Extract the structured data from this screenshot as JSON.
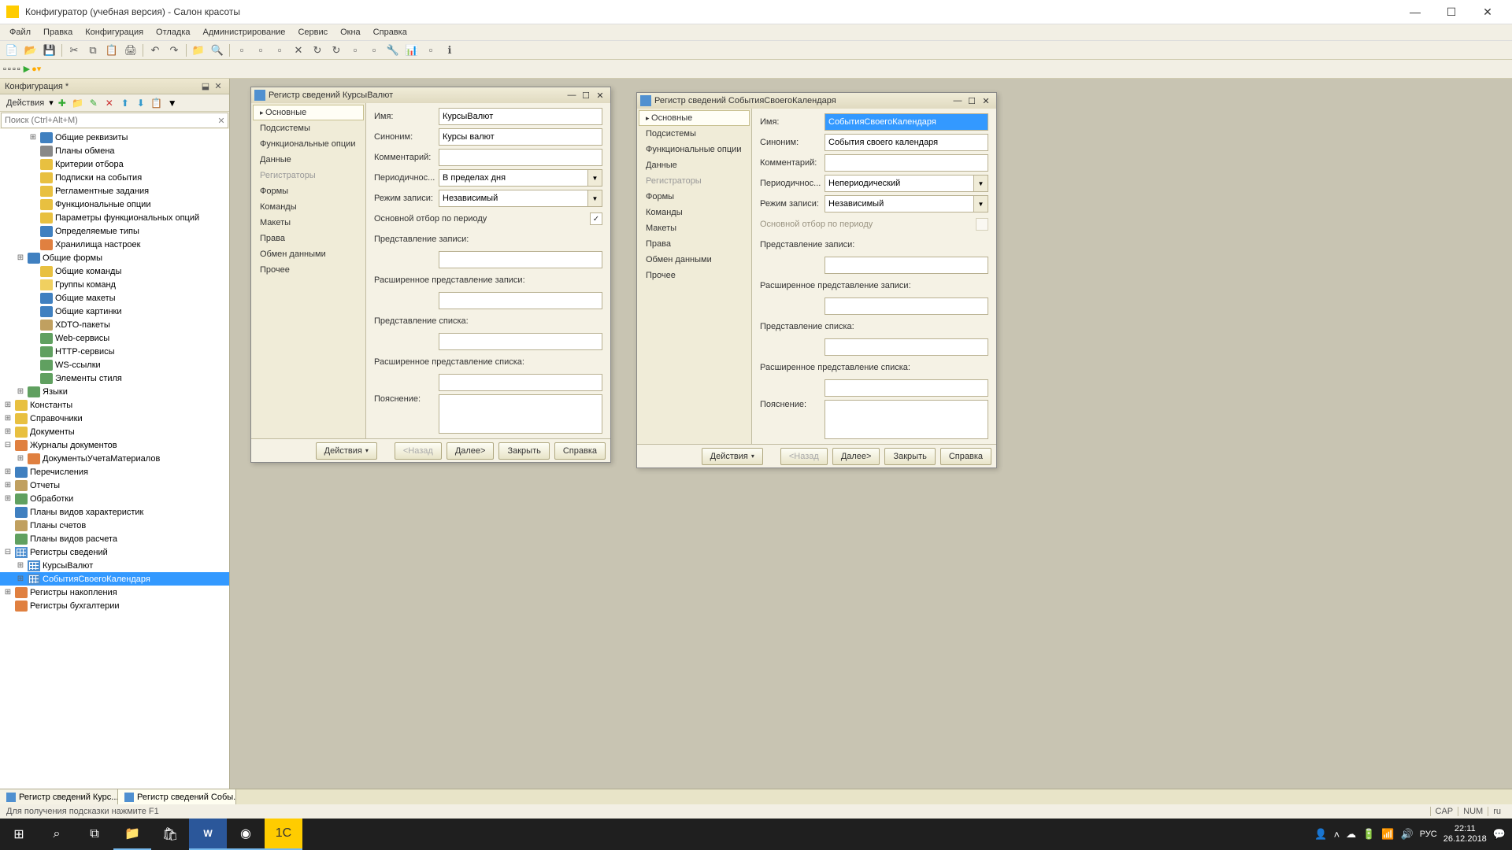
{
  "titlebar": {
    "title": "Конфигуратор (учебная версия) - Салон красоты"
  },
  "menubar": [
    "Файл",
    "Правка",
    "Конфигурация",
    "Отладка",
    "Администрирование",
    "Сервис",
    "Окна",
    "Справка"
  ],
  "config_panel": {
    "header": "Конфигурация *",
    "actions_label": "Действия",
    "search_placeholder": "Поиск (Ctrl+Alt+M)"
  },
  "tree": [
    {
      "d": 2,
      "t": "+",
      "ic": "blue",
      "label": "Общие реквизиты"
    },
    {
      "d": 2,
      "t": "",
      "ic": "grey",
      "label": "Планы обмена"
    },
    {
      "d": 2,
      "t": "",
      "ic": "yellow",
      "label": "Критерии отбора"
    },
    {
      "d": 2,
      "t": "",
      "ic": "yellow",
      "label": "Подписки на события"
    },
    {
      "d": 2,
      "t": "",
      "ic": "yellow",
      "label": "Регламентные задания"
    },
    {
      "d": 2,
      "t": "",
      "ic": "yellow",
      "label": "Функциональные опции"
    },
    {
      "d": 2,
      "t": "",
      "ic": "yellow",
      "label": "Параметры функциональных опций"
    },
    {
      "d": 2,
      "t": "",
      "ic": "blue",
      "label": "Определяемые типы"
    },
    {
      "d": 2,
      "t": "",
      "ic": "orange",
      "label": "Хранилища настроек"
    },
    {
      "d": 1,
      "t": "+",
      "ic": "blue",
      "label": "Общие формы"
    },
    {
      "d": 2,
      "t": "",
      "ic": "yellow",
      "label": "Общие команды"
    },
    {
      "d": 2,
      "t": "",
      "ic": "folder",
      "label": "Группы команд"
    },
    {
      "d": 2,
      "t": "",
      "ic": "blue",
      "label": "Общие макеты"
    },
    {
      "d": 2,
      "t": "",
      "ic": "blue",
      "label": "Общие картинки"
    },
    {
      "d": 2,
      "t": "",
      "ic": "tan",
      "label": "XDTO-пакеты"
    },
    {
      "d": 2,
      "t": "",
      "ic": "green",
      "label": "Web-сервисы"
    },
    {
      "d": 2,
      "t": "",
      "ic": "green",
      "label": "HTTP-сервисы"
    },
    {
      "d": 2,
      "t": "",
      "ic": "green",
      "label": "WS-ссылки"
    },
    {
      "d": 2,
      "t": "",
      "ic": "green",
      "label": "Элементы стиля"
    },
    {
      "d": 1,
      "t": "+",
      "ic": "green",
      "label": "Языки"
    },
    {
      "d": 0,
      "t": "+",
      "ic": "yellow",
      "label": "Константы"
    },
    {
      "d": 0,
      "t": "+",
      "ic": "yellow",
      "label": "Справочники"
    },
    {
      "d": 0,
      "t": "+",
      "ic": "yellow",
      "label": "Документы"
    },
    {
      "d": 0,
      "t": "-",
      "ic": "orange",
      "label": "Журналы документов"
    },
    {
      "d": 1,
      "t": "+",
      "ic": "orange",
      "label": "ДокументыУчетаМатериалов"
    },
    {
      "d": 0,
      "t": "+",
      "ic": "blue",
      "label": "Перечисления"
    },
    {
      "d": 0,
      "t": "+",
      "ic": "tan",
      "label": "Отчеты"
    },
    {
      "d": 0,
      "t": "+",
      "ic": "green",
      "label": "Обработки"
    },
    {
      "d": 0,
      "t": "",
      "ic": "blue",
      "label": "Планы видов характеристик"
    },
    {
      "d": 0,
      "t": "",
      "ic": "tan",
      "label": "Планы счетов"
    },
    {
      "d": 0,
      "t": "",
      "ic": "green",
      "label": "Планы видов расчета"
    },
    {
      "d": 0,
      "t": "-",
      "ic": "grid",
      "label": "Регистры сведений"
    },
    {
      "d": 1,
      "t": "+",
      "ic": "grid",
      "label": "КурсыВалют"
    },
    {
      "d": 1,
      "t": "+",
      "ic": "grid",
      "label": "СобытияСвоегоКалендаря",
      "sel": true
    },
    {
      "d": 0,
      "t": "+",
      "ic": "orange",
      "label": "Регистры накопления"
    },
    {
      "d": 0,
      "t": "",
      "ic": "orange",
      "label": "Регистры бухгалтерии"
    }
  ],
  "reg_nav": [
    {
      "label": "Основные",
      "active": true
    },
    {
      "label": "Подсистемы"
    },
    {
      "label": "Функциональные опции"
    },
    {
      "label": "Данные"
    },
    {
      "label": "Регистраторы",
      "muted": true
    },
    {
      "label": "Формы"
    },
    {
      "label": "Команды"
    },
    {
      "label": "Макеты"
    },
    {
      "label": "Права"
    },
    {
      "label": "Обмен данными"
    },
    {
      "label": "Прочее"
    }
  ],
  "form_labels": {
    "name": "Имя:",
    "synonym": "Синоним:",
    "comment": "Комментарий:",
    "periodicity": "Периодичнос...",
    "recmode": "Режим записи:",
    "mainfilter": "Основной отбор по периоду",
    "recview": "Представление записи:",
    "recview_ext": "Расширенное представление записи:",
    "listview": "Представление списка:",
    "listview_ext": "Расширенное представление списка:",
    "explain": "Пояснение:"
  },
  "window1": {
    "title": "Регистр сведений КурсыВалют",
    "name": "КурсыВалют",
    "synonym": "Курсы валют",
    "comment": "",
    "periodicity": "В пределах дня",
    "recmode": "Независимый",
    "mainfilter_checked": true
  },
  "window2": {
    "title": "Регистр сведений СобытияСвоегоКалендаря",
    "name": "СобытияСвоегоКалендаря",
    "synonym": "События своего календаря",
    "comment": "",
    "periodicity": "Непериодический",
    "recmode": "Независимый",
    "mainfilter_checked": false,
    "mainfilter_muted": true
  },
  "reg_buttons": {
    "actions": "Действия",
    "back": "<Назад",
    "next": "Далее>",
    "close": "Закрыть",
    "help": "Справка"
  },
  "bottom_tabs": [
    {
      "label": "Регистр сведений Курс..."
    },
    {
      "label": "Регистр сведений Собы...",
      "active": true
    }
  ],
  "statusbar": {
    "hint": "Для получения подсказки нажмите F1",
    "cap": "CAP",
    "num": "NUM",
    "lang": "ru"
  },
  "taskbar": {
    "lang": "РУС",
    "time": "22:11",
    "date": "26.12.2018"
  }
}
